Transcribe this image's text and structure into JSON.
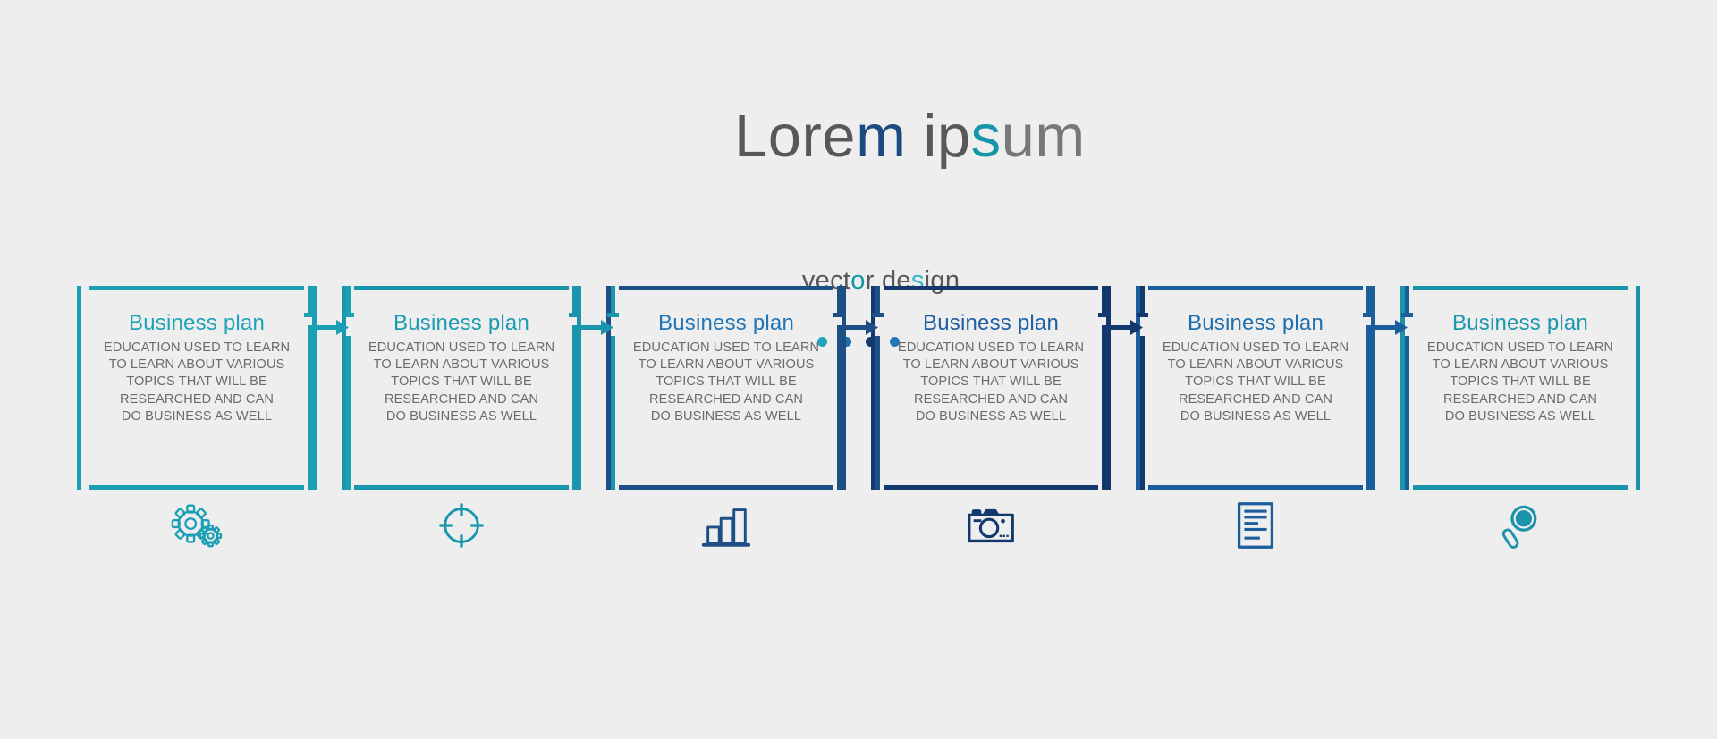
{
  "header": {
    "title_parts": [
      {
        "text": "Lore",
        "color": "#58585a"
      },
      {
        "text": "m",
        "color": "#1c4a82"
      },
      {
        "text": " ip",
        "color": "#58585a"
      },
      {
        "text": "s",
        "color": "#1596a8"
      },
      {
        "text": "um",
        "color": "#77787b"
      }
    ],
    "title_full": "Lorem ipsum",
    "subtitle_parts": [
      {
        "text": "vect",
        "color": "#58585a"
      },
      {
        "text": "o",
        "color": "#1596a8"
      },
      {
        "text": "r de",
        "color": "#58585a"
      },
      {
        "text": "s",
        "color": "#31b7c8"
      },
      {
        "text": "ign",
        "color": "#58585a"
      }
    ],
    "subtitle_full": "vector design",
    "dots": [
      {
        "name": "dot-1",
        "color": "#21a5bd"
      },
      {
        "name": "dot-2",
        "color": "#1d6fa8"
      },
      {
        "name": "dot-3",
        "color": "#16396e"
      },
      {
        "name": "dot-4",
        "color": "#2277b6"
      }
    ]
  },
  "steps": [
    {
      "title": "Business plan",
      "body": "EDUCATION USED TO LEARN\nTO LEARN ABOUT VARIOUS\nTOPICS THAT WILL BE\nRESEARCHED AND CAN\nDO BUSINESS AS WELL",
      "color": "#1b9fb5",
      "icon": "gears-icon"
    },
    {
      "title": "Business plan",
      "body": "EDUCATION USED TO LEARN\nTO LEARN ABOUT VARIOUS\nTOPICS THAT WILL BE\nRESEARCHED AND CAN\nDO BUSINESS AS WELL",
      "color": "#1996ae",
      "icon": "target-icon"
    },
    {
      "title": "Business plan",
      "body": "EDUCATION USED TO LEARN\nTO LEARN ABOUT VARIOUS\nTOPICS THAT WILL BE\nRESEARCHED AND CAN\nDO BUSINESS AS WELL",
      "color": "#1d4f84",
      "icon": "bar-chart-icon"
    },
    {
      "title": "Business plan",
      "body": "EDUCATION USED TO LEARN\nTO LEARN ABOUT VARIOUS\nTOPICS THAT WILL BE\nRESEARCHED AND CAN\nDO BUSINESS AS WELL",
      "color": "#12386d",
      "icon": "camera-icon"
    },
    {
      "title": "Business plan",
      "body": "EDUCATION USED TO LEARN\nTO LEARN ABOUT VARIOUS\nTOPICS THAT WILL BE\nRESEARCHED AND CAN\nDO BUSINESS AS WELL",
      "color": "#1a5e9c",
      "icon": "document-icon"
    },
    {
      "title": "Business plan",
      "body": "EDUCATION USED TO LEARN\nTO LEARN ABOUT VARIOUS\nTOPICS THAT WILL BE\nRESEARCHED AND CAN\nDO BUSINESS AS WELL",
      "color": "#1b93ab",
      "icon": "magnifier-icon"
    }
  ],
  "step_title_colors": [
    "#1fa3b8",
    "#1b9bb2",
    "#2076b8",
    "#1d5fa5",
    "#1d6fae",
    "#1b97ae"
  ],
  "connectors": [
    {
      "name": "connector-1-2",
      "color": "#1b9fb5"
    },
    {
      "name": "connector-2-3",
      "color": "#1996ae"
    },
    {
      "name": "connector-3-4",
      "color": "#1d4f84"
    },
    {
      "name": "connector-4-5",
      "color": "#12386d"
    },
    {
      "name": "connector-5-6",
      "color": "#1a5e9c"
    }
  ],
  "background": "#eeeeee"
}
